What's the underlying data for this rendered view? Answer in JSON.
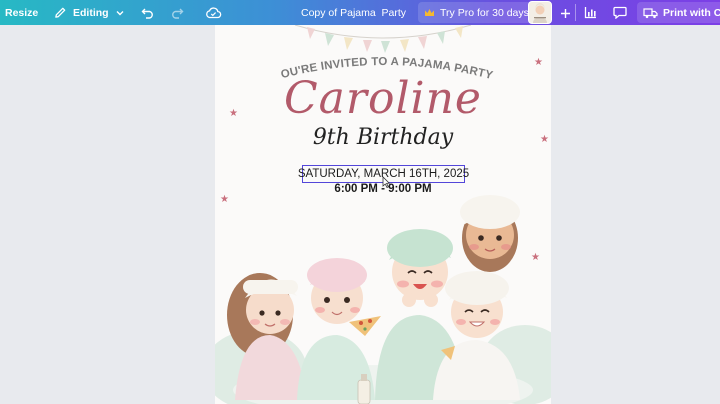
{
  "toolbar": {
    "resize_label": "Resize",
    "editing_label": "Editing",
    "document_title": "Copy of Pajama  Party",
    "try_pro_label": "Try Pro for 30 days",
    "print_label": "Print with Canva",
    "icons": {
      "edit": "pencil-icon",
      "dropdown": "chevron-down-icon",
      "undo": "undo-icon",
      "redo": "redo-icon",
      "save_status": "cloud-check-icon",
      "pro": "crown-icon",
      "add": "plus-icon",
      "analytics": "bar-chart-icon",
      "comments": "comment-icon",
      "print": "truck-icon"
    },
    "colors": {
      "gradient_start": "#27b9c4",
      "gradient_end": "#7c3fe6",
      "pro_crown": "#f5b830"
    }
  },
  "design": {
    "invite_line": "YOU'RE INVITED TO A PAJAMA PARTY!",
    "name": "Caroline",
    "birthday_line": "9th Birthday",
    "date_line": "SATURDAY, MARCH 16TH, 2025",
    "time_line": "6:00 PM - 9:00 PM",
    "colors": {
      "name": "#b25a6a",
      "selection": "#5346d9",
      "invite_text": "#7a7a7a"
    }
  }
}
